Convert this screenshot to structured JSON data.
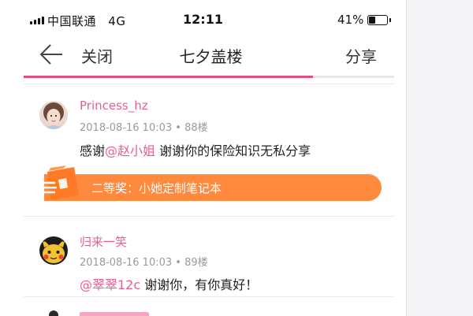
{
  "status_bar": {
    "carrier": "中国联通",
    "network": "4G",
    "time": "12:11",
    "battery_percent": "41%",
    "battery_level": 0.41
  },
  "nav": {
    "close_label": "关闭",
    "title": "七夕盖楼",
    "share_label": "分享"
  },
  "read_progress": 0.78,
  "colors": {
    "accent_pink": "#e8608a",
    "progress_pink": "#e0507a",
    "prize_orange": "#ff8a3d"
  },
  "comments": [
    {
      "username": "Princess_hz",
      "meta": "2018-08-16 10:03 • 88楼",
      "text_prefix": "感谢",
      "mention": "@赵小姐",
      "text_suffix": " 谢谢你的保险知识无私分享",
      "prize": "二等奖：小她定制笔记本"
    },
    {
      "username": "归来一笑",
      "meta": "2018-08-16 10:03 • 89楼",
      "text_prefix": "",
      "mention": "@翠翠12c",
      "text_suffix": " 谢谢你，有你真好！"
    }
  ]
}
